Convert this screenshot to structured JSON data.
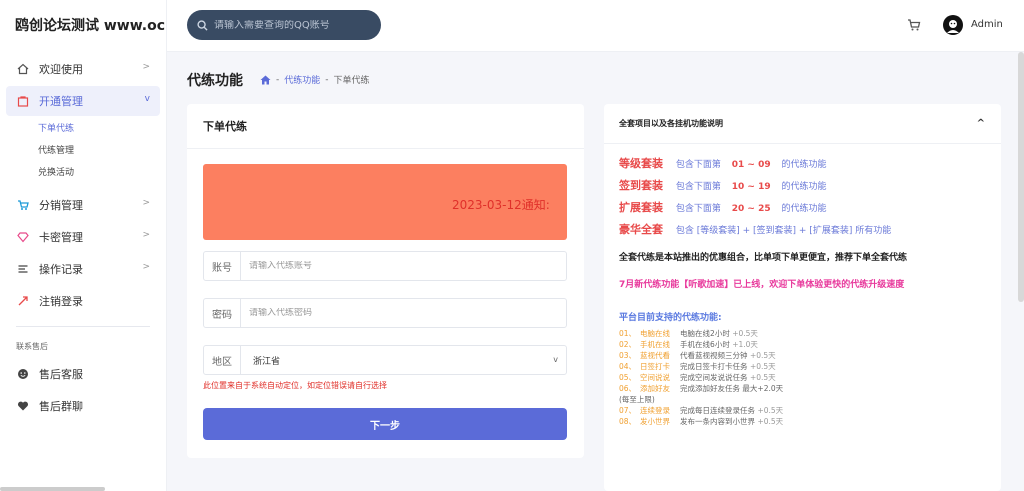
{
  "sidebar": {
    "brand": "鸥创论坛测试 www.ocbb",
    "items": [
      {
        "label": "欢迎使用"
      },
      {
        "label": "开通管理"
      },
      {
        "label": "分销管理"
      },
      {
        "label": "卡密管理"
      },
      {
        "label": "操作记录"
      },
      {
        "label": "注销登录"
      }
    ],
    "subitems": [
      "下单代练",
      "代练管理",
      "兑换活动"
    ],
    "section_label": "联系售后",
    "after_sales": [
      "售后客服",
      "售后群聊"
    ]
  },
  "header": {
    "search_placeholder": "请输入需要查询的QQ账号",
    "username": "Admin"
  },
  "page": {
    "title": "代练功能",
    "breadcrumb": [
      "代练功能",
      "下单代练"
    ]
  },
  "form": {
    "title": "下单代练",
    "notice_text": "2023-03-12通知:",
    "account_label": "账号",
    "account_placeholder": "请输入代练账号",
    "password_label": "密码",
    "password_placeholder": "请输入代练密码",
    "region_label": "地区",
    "region_value": "浙江省",
    "hint": "此位置来自于系统自动定位，如定位错误请自行选择",
    "next_button": "下一步"
  },
  "info": {
    "title": "全套项目以及各挂机功能说明",
    "packages": [
      {
        "name": "等级套装",
        "prefix": "包含下面第",
        "range": "01 ~ 09",
        "suffix": "的代练功能"
      },
      {
        "name": "签到套装",
        "prefix": "包含下面第",
        "range": "10 ~ 19",
        "suffix": "的代练功能"
      },
      {
        "name": "扩展套装",
        "prefix": "包含下面第",
        "range": "20 ~ 25",
        "suffix": "的代练功能"
      },
      {
        "name": "豪华全套",
        "prefix": "包含 [等级套装] + [签到套装] + [扩展套装] 所有功能",
        "range": "",
        "suffix": ""
      }
    ],
    "summary": "全套代练是本站推出的优惠组合，比单项下单更便宜，推荐下单全套代练",
    "july_notice": "7月新代练功能【听歌加速】已上线，欢迎下单体验更快的代练升级速度",
    "supported_title": "平台目前支持的代练功能:",
    "features": [
      {
        "no": "01、",
        "name": "电脑在线",
        "desc": "电脑在线2小时",
        "plus": "+0.5天"
      },
      {
        "no": "02、",
        "name": "手机在线",
        "desc": "手机在线6小时",
        "plus": "+1.0天"
      },
      {
        "no": "03、",
        "name": "蓝视代看",
        "desc": "代看蓝视视频三分钟",
        "plus": "+0.5天"
      },
      {
        "no": "04、",
        "name": "日签打卡",
        "desc": "完成日签卡打卡任务",
        "plus": "+0.5天"
      },
      {
        "no": "05、",
        "name": "空间说说",
        "desc": "完成空间发说说任务",
        "plus": "+0.5天"
      },
      {
        "no": "06、",
        "name": "添加好友",
        "desc": "完成添加好友任务 最大+2.0天(每至上限)",
        "plus": ""
      },
      {
        "no": "07、",
        "name": "连续登录",
        "desc": "完成每日连续登录任务",
        "plus": "+0.5天"
      },
      {
        "no": "08、",
        "name": "发小世界",
        "desc": "发布一条内容到小世界",
        "plus": "+0.5天"
      }
    ]
  }
}
